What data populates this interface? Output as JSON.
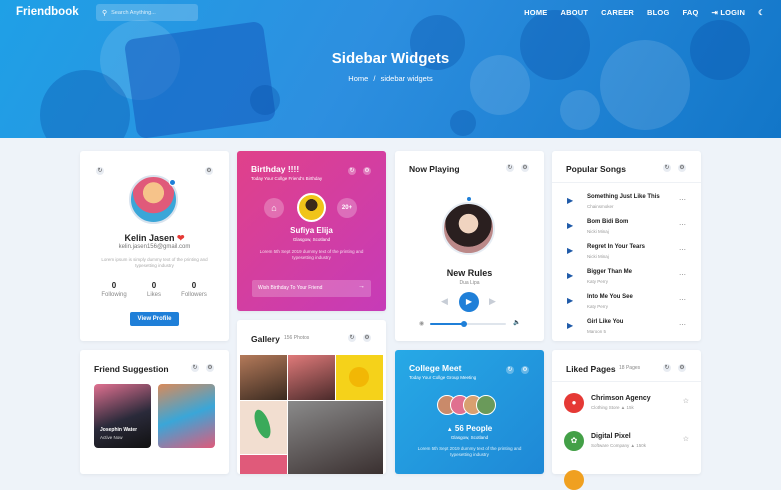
{
  "nav": {
    "logo": "Friendbook",
    "search_placeholder": "Search Anything...",
    "items": [
      "HOME",
      "ABOUT",
      "CAREER",
      "BLOG",
      "FAQ"
    ],
    "login": "LOGIN"
  },
  "hero": {
    "title": "Sidebar Widgets",
    "crumb_home": "Home",
    "crumb_sep": "/",
    "crumb_current": "sidebar widgets"
  },
  "profile": {
    "name": "Kelin Jasen",
    "email": "kelin.jasen156@gmail.com",
    "bio": "Lorem ipsum is simply dummy text of the printing and typesetting industry",
    "stats": [
      {
        "value": "0",
        "label": "Following"
      },
      {
        "value": "0",
        "label": "Likes"
      },
      {
        "value": "0",
        "label": "Followers"
      }
    ],
    "button": "View Profile"
  },
  "birthday": {
    "title": "Birthday !!!!",
    "subtitle": "Today Your Collge Friend's Birthday",
    "name": "Sufiya Elija",
    "location": "Glasgow, Scotland",
    "age": "20+",
    "text": "Lorem 5th Sept 2019 dummy text of the printing and typesetting industry",
    "wish": "Wish Birthday To Your Friend"
  },
  "now_playing": {
    "title": "Now Playing",
    "song": "New Rules",
    "artist": "Dua Lipa",
    "progress": 0.45,
    "volume": 0.7
  },
  "popular": {
    "title": "Popular Songs",
    "songs": [
      {
        "title": "Something Just Like This",
        "artist": "Chainsmoker"
      },
      {
        "title": "Bom Bidi Bom",
        "artist": "Nicki Minaj"
      },
      {
        "title": "Regret In Your Tears",
        "artist": "Nicki Minaj"
      },
      {
        "title": "Bigger Than Me",
        "artist": "Katy Perry"
      },
      {
        "title": "Into Me You See",
        "artist": "Katy Perry"
      },
      {
        "title": "Girl Like You",
        "artist": "Maroon 5"
      }
    ]
  },
  "suggestion": {
    "title": "Friend Suggestion",
    "name": "Josephin Water",
    "status": "Active Now"
  },
  "gallery": {
    "title": "Gallery",
    "count": "156 Photos"
  },
  "college": {
    "title": "College Meet",
    "subtitle": "Today Your Collge Group Meeting",
    "people": "56 People",
    "location": "Glasgow, Scotland",
    "text": "Lorem 5th Sept 2019 dummy text of the printing and typesetting industry"
  },
  "liked": {
    "title": "Liked Pages",
    "count": "18 Pages",
    "pages": [
      {
        "name": "Chrimson Agency",
        "meta": "Clothing Store",
        "likes": "15k",
        "color": "#e53935"
      },
      {
        "name": "Digital Pixel",
        "meta": "Software Company",
        "likes": "150k",
        "color": "#43a047"
      }
    ]
  },
  "colors": {
    "accent": "#1f7fd8",
    "heart": "#e53935",
    "birthday": "#d9367f"
  }
}
